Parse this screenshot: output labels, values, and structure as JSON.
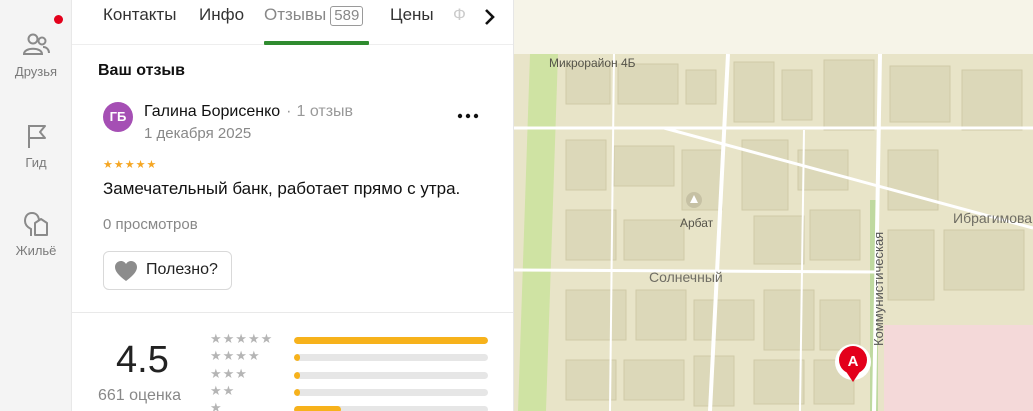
{
  "sidebar": {
    "items": [
      {
        "label": "Друзья",
        "icon": "friends-icon"
      },
      {
        "label": "Гид",
        "icon": "flag-icon"
      },
      {
        "label": "Жильё",
        "icon": "housing-icon"
      }
    ]
  },
  "tabs": {
    "items": [
      {
        "label": "Контакты"
      },
      {
        "label": "Инфо"
      },
      {
        "label": "Отзывы",
        "count": "589",
        "active": true
      },
      {
        "label": "Цены"
      },
      {
        "label": "Ф"
      }
    ]
  },
  "review": {
    "section_title": "Ваш отзыв",
    "avatar_initials": "ГБ",
    "avatar_color": "#a54fb4",
    "author": "Галина Борисенко",
    "author_reviews": "1 отзыв",
    "date": "1 декабря 2025",
    "stars": "★★★★★",
    "text": "Замечательный банк, работает прямо с утра.",
    "views": "0 просмотров",
    "useful_label": "Полезно?"
  },
  "rating": {
    "value": "4.5",
    "count_label": "661 оценка",
    "distribution": [
      {
        "stars": "★★★★★",
        "fraction": 1.0
      },
      {
        "stars": "★★★★",
        "fraction": 0.03
      },
      {
        "stars": "★★★",
        "fraction": 0.03
      },
      {
        "stars": "★★",
        "fraction": 0.03
      },
      {
        "stars": "★",
        "fraction": 0.24
      }
    ]
  },
  "map": {
    "labels": {
      "district": "Микрорайон 4Б",
      "place": "Арбат",
      "area": "Солнечный",
      "street_right": "Ибрагимова",
      "street_vertical": "Коммунистическая"
    },
    "marker_letter": "А"
  },
  "colors": {
    "accent": "#2f8b2f",
    "rating": "#f7b21b",
    "marker": "#e3001b",
    "map_bg": "#e9e5cd"
  }
}
